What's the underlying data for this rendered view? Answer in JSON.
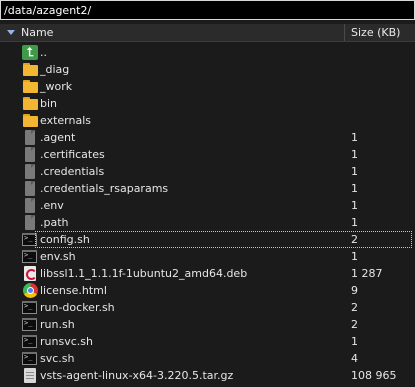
{
  "path_bar": {
    "value": "/data/azagent2/"
  },
  "header": {
    "name_label": "Name",
    "size_label": "Size (KB)"
  },
  "files": [
    {
      "name": "..",
      "size": "",
      "icon": "parent-folder-icon"
    },
    {
      "name": "_diag",
      "size": "",
      "icon": "folder-icon"
    },
    {
      "name": "_work",
      "size": "",
      "icon": "folder-icon"
    },
    {
      "name": "bin",
      "size": "",
      "icon": "folder-icon"
    },
    {
      "name": "externals",
      "size": "",
      "icon": "folder-icon"
    },
    {
      "name": ".agent",
      "size": "1",
      "icon": "file-icon"
    },
    {
      "name": ".certificates",
      "size": "1",
      "icon": "file-icon"
    },
    {
      "name": ".credentials",
      "size": "1",
      "icon": "file-icon"
    },
    {
      "name": ".credentials_rsaparams",
      "size": "1",
      "icon": "file-icon"
    },
    {
      "name": ".env",
      "size": "1",
      "icon": "file-icon"
    },
    {
      "name": ".path",
      "size": "1",
      "icon": "file-icon"
    },
    {
      "name": "config.sh",
      "size": "2",
      "icon": "shell-script-icon",
      "focused": true
    },
    {
      "name": "env.sh",
      "size": "1",
      "icon": "shell-script-icon"
    },
    {
      "name": "libssl1.1_1.1.1f-1ubuntu2_amd64.deb",
      "size": "1 287",
      "icon": "debian-package-icon"
    },
    {
      "name": "license.html",
      "size": "9",
      "icon": "chrome-html-icon"
    },
    {
      "name": "run-docker.sh",
      "size": "2",
      "icon": "shell-script-icon"
    },
    {
      "name": "run.sh",
      "size": "2",
      "icon": "shell-script-icon"
    },
    {
      "name": "runsvc.sh",
      "size": "1",
      "icon": "shell-script-icon"
    },
    {
      "name": "svc.sh",
      "size": "4",
      "icon": "shell-script-icon"
    },
    {
      "name": "vsts-agent-linux-x64-3.220.5.tar.gz",
      "size": "108 965",
      "icon": "archive-icon"
    }
  ]
}
